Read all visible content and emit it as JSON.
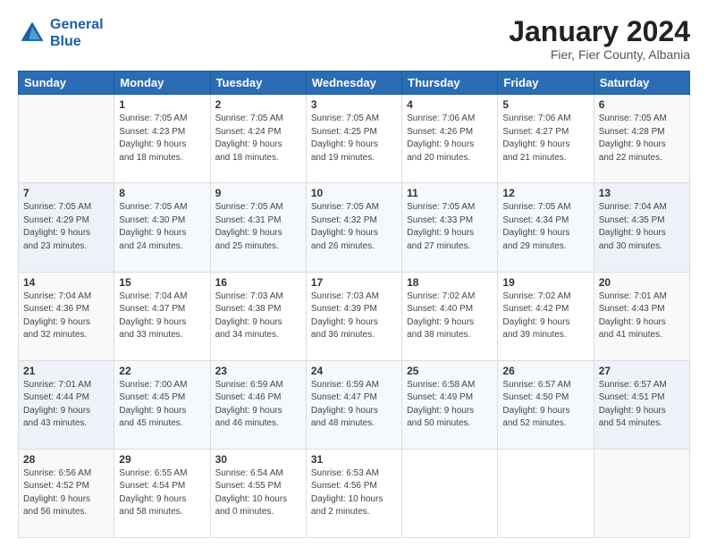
{
  "header": {
    "logo_line1": "General",
    "logo_line2": "Blue",
    "main_title": "January 2024",
    "subtitle": "Fier, Fier County, Albania"
  },
  "weekdays": [
    "Sunday",
    "Monday",
    "Tuesday",
    "Wednesday",
    "Thursday",
    "Friday",
    "Saturday"
  ],
  "weeks": [
    [
      {
        "day": "",
        "info": ""
      },
      {
        "day": "1",
        "info": "Sunrise: 7:05 AM\nSunset: 4:23 PM\nDaylight: 9 hours\nand 18 minutes."
      },
      {
        "day": "2",
        "info": "Sunrise: 7:05 AM\nSunset: 4:24 PM\nDaylight: 9 hours\nand 18 minutes."
      },
      {
        "day": "3",
        "info": "Sunrise: 7:05 AM\nSunset: 4:25 PM\nDaylight: 9 hours\nand 19 minutes."
      },
      {
        "day": "4",
        "info": "Sunrise: 7:06 AM\nSunset: 4:26 PM\nDaylight: 9 hours\nand 20 minutes."
      },
      {
        "day": "5",
        "info": "Sunrise: 7:06 AM\nSunset: 4:27 PM\nDaylight: 9 hours\nand 21 minutes."
      },
      {
        "day": "6",
        "info": "Sunrise: 7:05 AM\nSunset: 4:28 PM\nDaylight: 9 hours\nand 22 minutes."
      }
    ],
    [
      {
        "day": "7",
        "info": "Sunrise: 7:05 AM\nSunset: 4:29 PM\nDaylight: 9 hours\nand 23 minutes."
      },
      {
        "day": "8",
        "info": "Sunrise: 7:05 AM\nSunset: 4:30 PM\nDaylight: 9 hours\nand 24 minutes."
      },
      {
        "day": "9",
        "info": "Sunrise: 7:05 AM\nSunset: 4:31 PM\nDaylight: 9 hours\nand 25 minutes."
      },
      {
        "day": "10",
        "info": "Sunrise: 7:05 AM\nSunset: 4:32 PM\nDaylight: 9 hours\nand 26 minutes."
      },
      {
        "day": "11",
        "info": "Sunrise: 7:05 AM\nSunset: 4:33 PM\nDaylight: 9 hours\nand 27 minutes."
      },
      {
        "day": "12",
        "info": "Sunrise: 7:05 AM\nSunset: 4:34 PM\nDaylight: 9 hours\nand 29 minutes."
      },
      {
        "day": "13",
        "info": "Sunrise: 7:04 AM\nSunset: 4:35 PM\nDaylight: 9 hours\nand 30 minutes."
      }
    ],
    [
      {
        "day": "14",
        "info": "Sunrise: 7:04 AM\nSunset: 4:36 PM\nDaylight: 9 hours\nand 32 minutes."
      },
      {
        "day": "15",
        "info": "Sunrise: 7:04 AM\nSunset: 4:37 PM\nDaylight: 9 hours\nand 33 minutes."
      },
      {
        "day": "16",
        "info": "Sunrise: 7:03 AM\nSunset: 4:38 PM\nDaylight: 9 hours\nand 34 minutes."
      },
      {
        "day": "17",
        "info": "Sunrise: 7:03 AM\nSunset: 4:39 PM\nDaylight: 9 hours\nand 36 minutes."
      },
      {
        "day": "18",
        "info": "Sunrise: 7:02 AM\nSunset: 4:40 PM\nDaylight: 9 hours\nand 38 minutes."
      },
      {
        "day": "19",
        "info": "Sunrise: 7:02 AM\nSunset: 4:42 PM\nDaylight: 9 hours\nand 39 minutes."
      },
      {
        "day": "20",
        "info": "Sunrise: 7:01 AM\nSunset: 4:43 PM\nDaylight: 9 hours\nand 41 minutes."
      }
    ],
    [
      {
        "day": "21",
        "info": "Sunrise: 7:01 AM\nSunset: 4:44 PM\nDaylight: 9 hours\nand 43 minutes."
      },
      {
        "day": "22",
        "info": "Sunrise: 7:00 AM\nSunset: 4:45 PM\nDaylight: 9 hours\nand 45 minutes."
      },
      {
        "day": "23",
        "info": "Sunrise: 6:59 AM\nSunset: 4:46 PM\nDaylight: 9 hours\nand 46 minutes."
      },
      {
        "day": "24",
        "info": "Sunrise: 6:59 AM\nSunset: 4:47 PM\nDaylight: 9 hours\nand 48 minutes."
      },
      {
        "day": "25",
        "info": "Sunrise: 6:58 AM\nSunset: 4:49 PM\nDaylight: 9 hours\nand 50 minutes."
      },
      {
        "day": "26",
        "info": "Sunrise: 6:57 AM\nSunset: 4:50 PM\nDaylight: 9 hours\nand 52 minutes."
      },
      {
        "day": "27",
        "info": "Sunrise: 6:57 AM\nSunset: 4:51 PM\nDaylight: 9 hours\nand 54 minutes."
      }
    ],
    [
      {
        "day": "28",
        "info": "Sunrise: 6:56 AM\nSunset: 4:52 PM\nDaylight: 9 hours\nand 56 minutes."
      },
      {
        "day": "29",
        "info": "Sunrise: 6:55 AM\nSunset: 4:54 PM\nDaylight: 9 hours\nand 58 minutes."
      },
      {
        "day": "30",
        "info": "Sunrise: 6:54 AM\nSunset: 4:55 PM\nDaylight: 10 hours\nand 0 minutes."
      },
      {
        "day": "31",
        "info": "Sunrise: 6:53 AM\nSunset: 4:56 PM\nDaylight: 10 hours\nand 2 minutes."
      },
      {
        "day": "",
        "info": ""
      },
      {
        "day": "",
        "info": ""
      },
      {
        "day": "",
        "info": ""
      }
    ]
  ]
}
